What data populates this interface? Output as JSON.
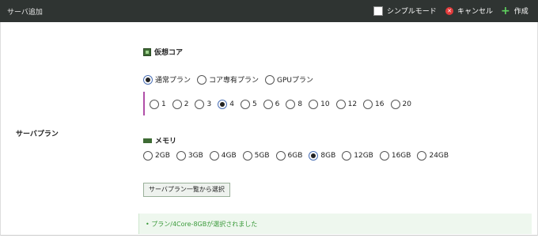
{
  "header": {
    "title": "サーバ追加",
    "simple_mode_label": "シンプルモード",
    "cancel_label": "キャンセル",
    "create_label": "作成"
  },
  "row_label": "サーバプラン",
  "cpu": {
    "heading": "仮想コア",
    "plan_types": [
      {
        "label": "通常プラン",
        "checked": true
      },
      {
        "label": "コア専有プラン",
        "checked": false
      },
      {
        "label": "GPUプラン",
        "checked": false
      }
    ],
    "core_options": [
      {
        "label": "1",
        "checked": false
      },
      {
        "label": "2",
        "checked": false
      },
      {
        "label": "3",
        "checked": false
      },
      {
        "label": "4",
        "checked": true
      },
      {
        "label": "5",
        "checked": false
      },
      {
        "label": "6",
        "checked": false
      },
      {
        "label": "8",
        "checked": false
      },
      {
        "label": "10",
        "checked": false
      },
      {
        "label": "12",
        "checked": false
      },
      {
        "label": "16",
        "checked": false
      },
      {
        "label": "20",
        "checked": false
      }
    ]
  },
  "memory": {
    "heading": "メモリ",
    "options": [
      {
        "label": "2GB",
        "checked": false
      },
      {
        "label": "3GB",
        "checked": false
      },
      {
        "label": "4GB",
        "checked": false
      },
      {
        "label": "5GB",
        "checked": false
      },
      {
        "label": "6GB",
        "checked": false
      },
      {
        "label": "8GB",
        "checked": true
      },
      {
        "label": "12GB",
        "checked": false
      },
      {
        "label": "16GB",
        "checked": false
      },
      {
        "label": "24GB",
        "checked": false
      }
    ]
  },
  "select_from_list_label": "サーバプラン一覧から選択",
  "notice_text": "•  プラン/4Core-8GBが選択されました"
}
